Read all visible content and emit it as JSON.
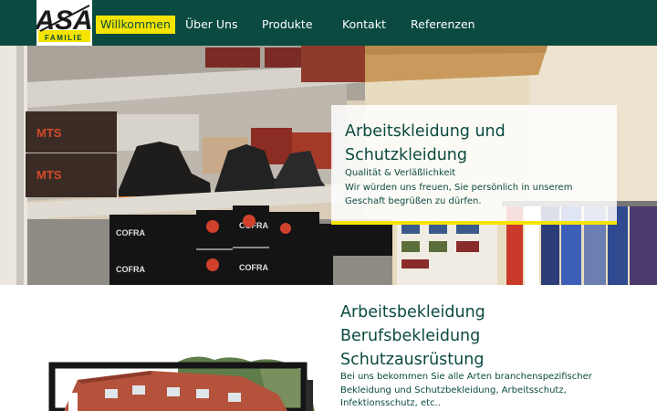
{
  "logo": {
    "text_top": "ASA",
    "text_bottom": "FAMILIE"
  },
  "nav": {
    "items": [
      {
        "label": "Willkommen",
        "active": true
      },
      {
        "label": "Über Uns",
        "active": false
      },
      {
        "label": "Produkte",
        "active": false
      },
      {
        "label": "Kontakt",
        "active": false
      },
      {
        "label": "Referenzen",
        "active": false
      }
    ]
  },
  "hero": {
    "title": "Arbeitskleidung und Schutzkleidung",
    "subtitle": "Qualität & Verläßlichkeit",
    "text": "Wir würden uns freuen, Sie persönlich in unserem Geschaft begrüßen zu dürfen.",
    "box_labels": [
      "MTS",
      "MTS",
      "COFRA",
      "COFRA",
      "COFRA",
      "COFRA"
    ]
  },
  "lower": {
    "headings": [
      "Arbeitsbekleidung",
      "Berufsbekleidung",
      "Schutzausrüstung"
    ],
    "text": "Bei uns bekommen Sie alle Arten branchenspezifischer Bekleidung und Schutzbekleidung, Arbeitsschutz, Infektionsschutz, etc.."
  },
  "colors": {
    "brand": "#0a4a40",
    "accent": "#f5e400"
  }
}
